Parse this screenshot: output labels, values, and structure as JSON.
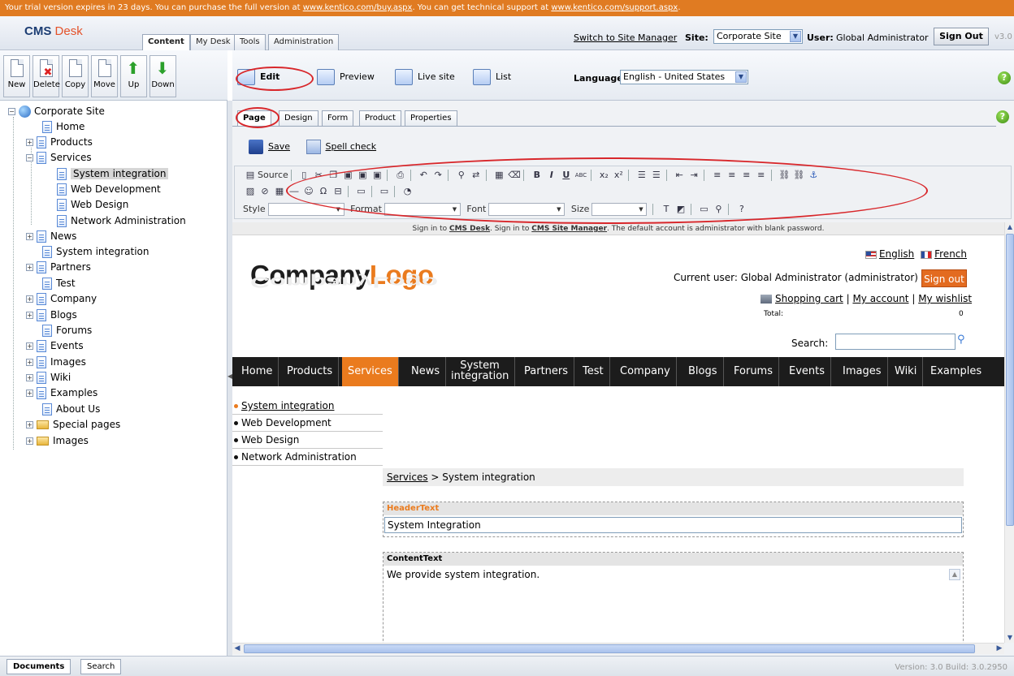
{
  "trial": {
    "text_1": "Your trial version expires in 23 days. You can purchase the full version at ",
    "link_1": "www.kentico.com/buy.aspx",
    "text_2": ". You can get technical support at ",
    "link_2": "www.kentico.com/support.aspx",
    "text_3": "."
  },
  "header": {
    "logo_cms": "CMS",
    "logo_desk": "Desk",
    "tabs": [
      "Content",
      "My Desk",
      "Tools",
      "Administration"
    ],
    "switch_link": "Switch to Site Manager",
    "site_label": "Site:",
    "site_value": "Corporate Site",
    "user_label": "User:",
    "user_value": "Global Administrator",
    "sign_out": "Sign Out",
    "version_short": "v3.0"
  },
  "left_toolbar": {
    "buttons": [
      "New",
      "Delete",
      "Copy",
      "Move",
      "Up",
      "Down"
    ]
  },
  "view_toolbar": {
    "edit": "Edit",
    "preview": "Preview",
    "live_site": "Live site",
    "list": "List",
    "language_label": "Language:",
    "language_value": "English - United States"
  },
  "tree": {
    "root": "Corporate Site",
    "items": [
      "Home",
      "Products",
      "Services",
      "System integration",
      "Web Development",
      "Web Design",
      "Network Administration",
      "News",
      "System integration",
      "Partners",
      "Test",
      "Company",
      "Blogs",
      "Forums",
      "Events",
      "Images",
      "Wiki",
      "Examples",
      "About Us",
      "Special pages",
      "Images"
    ]
  },
  "page_tabs": [
    "Page",
    "Design",
    "Form",
    "Product",
    "Properties"
  ],
  "actions": {
    "save": "Save",
    "spell_check": "Spell check"
  },
  "fck": {
    "source": "Source",
    "style": "Style",
    "format": "Format",
    "font": "Font",
    "size": "Size"
  },
  "preview": {
    "signin_1": "Sign in to ",
    "signin_cms": "CMS Desk",
    "signin_2": ". Sign in to ",
    "signin_sm": "CMS Site Manager",
    "signin_3": ". The default account is administrator with blank password.",
    "logo_part1": "Company",
    "logo_part2": "Logo",
    "lang_english": "English",
    "lang_french": "French",
    "current_user": "Current user:  Global Administrator (administrator)",
    "sign_out": "Sign out",
    "shopping_cart": "Shopping cart",
    "sep": " | ",
    "my_account": "My account",
    "my_wishlist": "My wishlist",
    "total_label": "Total:",
    "total_value": "0",
    "search_label": "Search:",
    "menu": [
      "Home",
      "Products",
      "Services",
      "News",
      "System integration",
      "Partners",
      "Test",
      "Company",
      "Blogs",
      "Forums",
      "Events",
      "Images",
      "Wiki",
      "Examples"
    ],
    "submenu": [
      "System integration",
      "Web Development",
      "Web Design",
      "Network Administration"
    ],
    "breadcrumb_link": "Services",
    "breadcrumb_rest": " > System integration",
    "header_region": "HeaderText",
    "header_value": "System Integration",
    "content_region": "ContentText",
    "content_value": "We provide system integration."
  },
  "bottom": {
    "tabs": [
      "Documents",
      "Search"
    ],
    "version": "Version: 3.0 Build: 3.0.2950"
  }
}
